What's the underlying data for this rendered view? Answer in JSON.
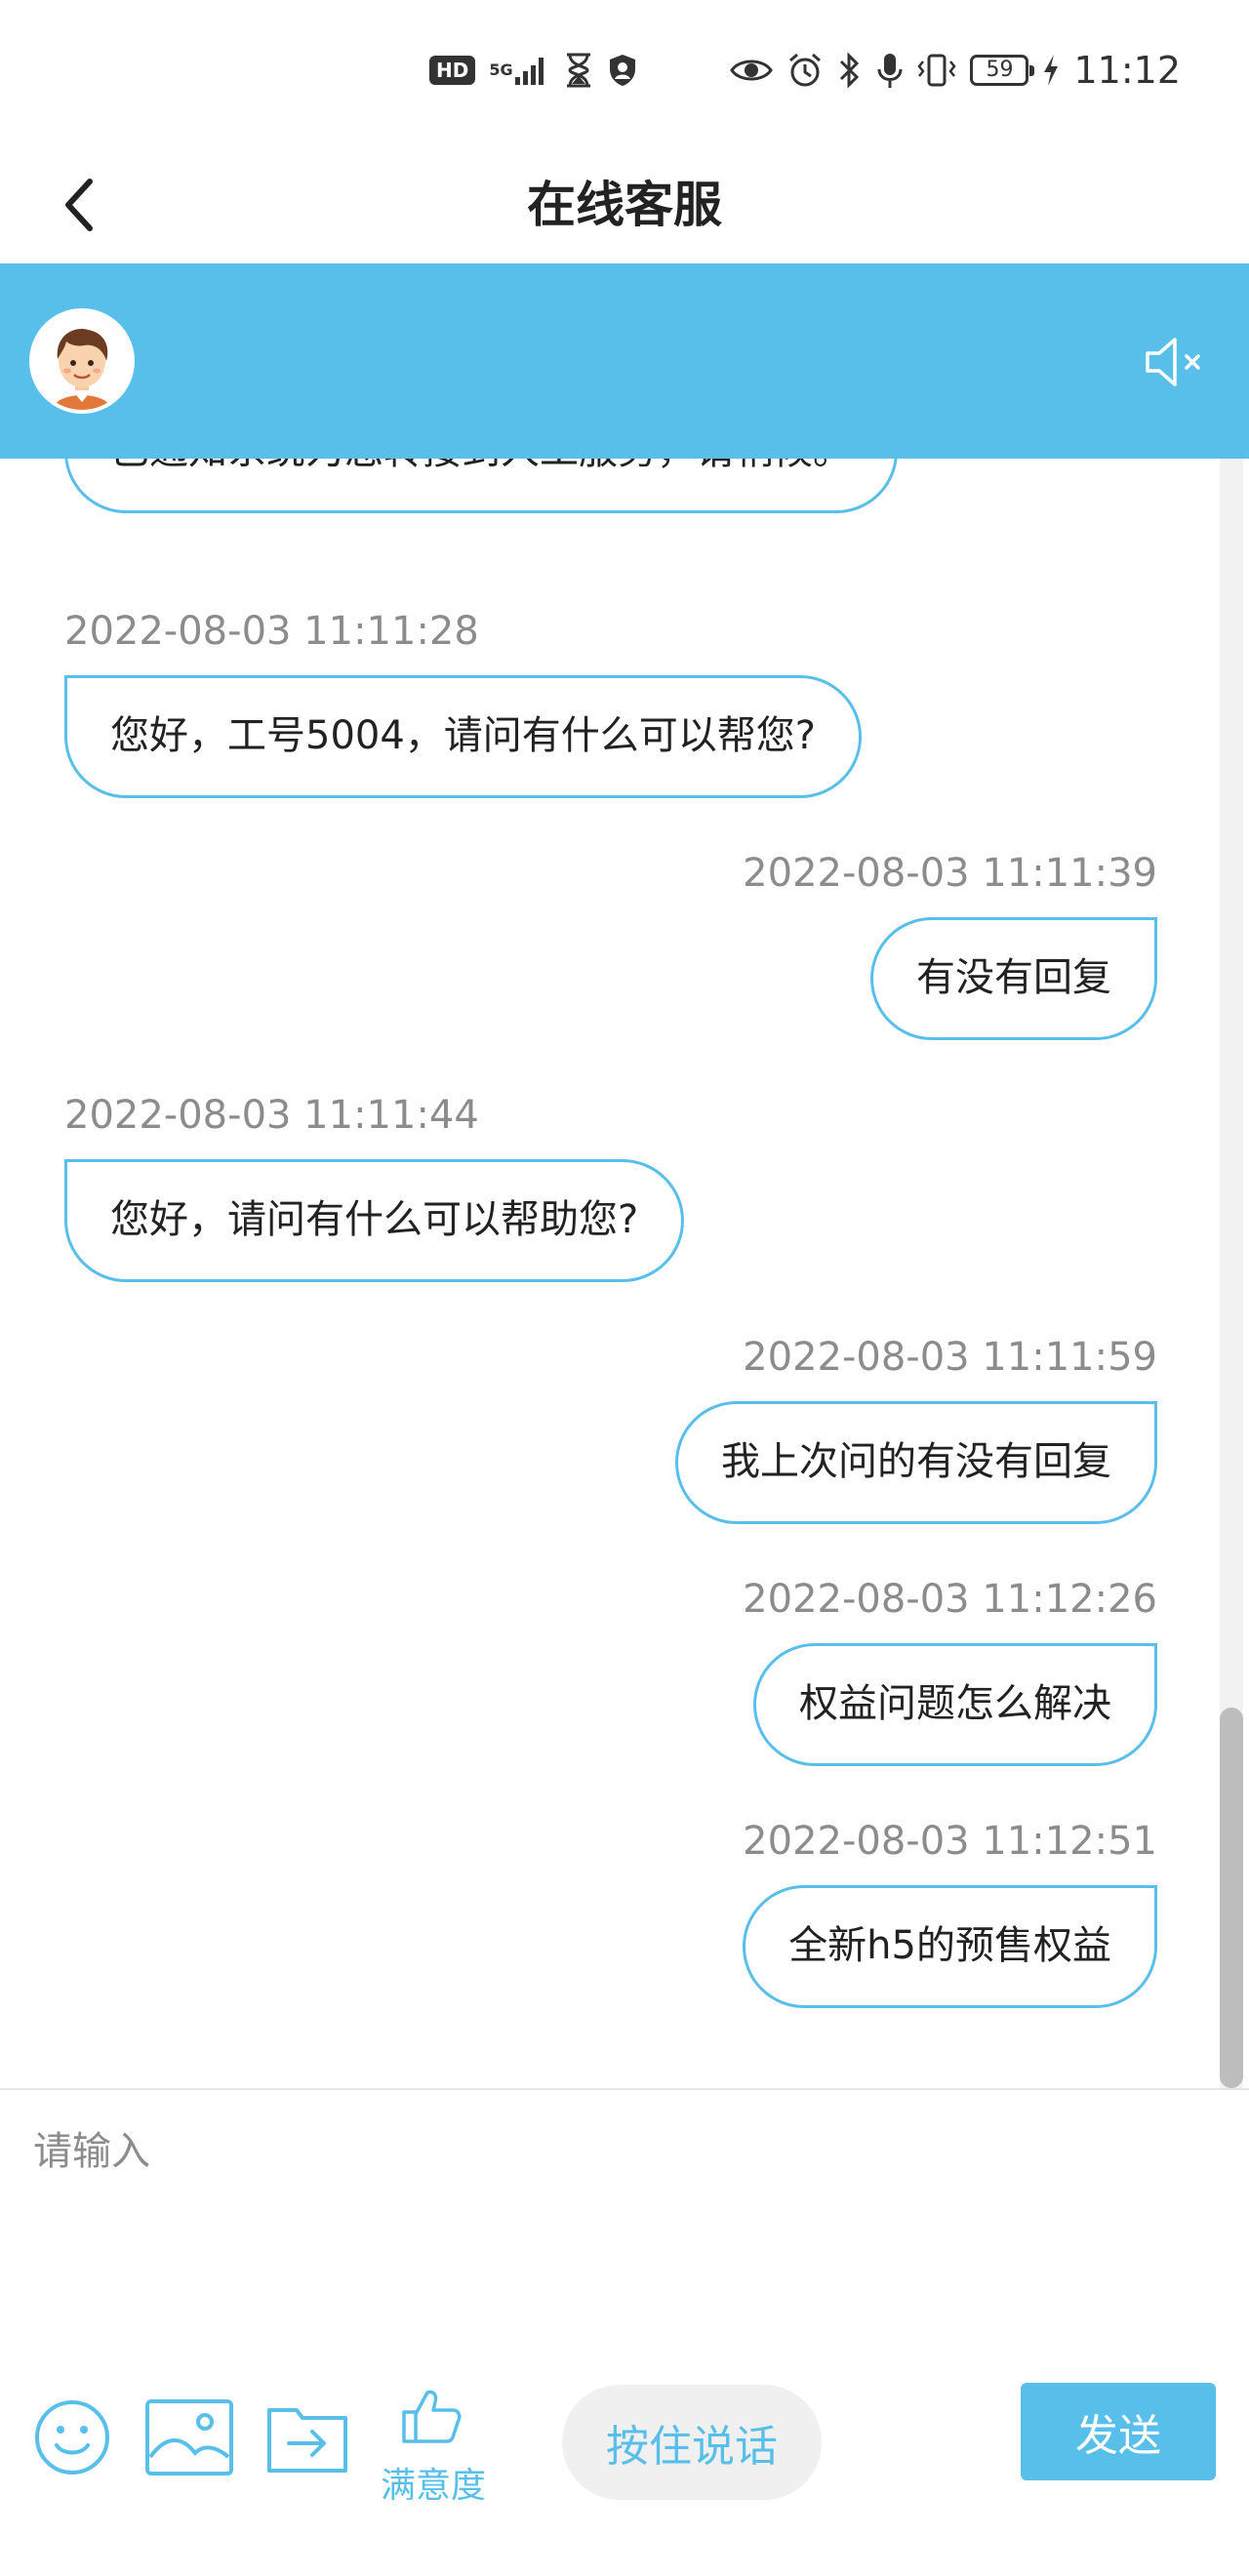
{
  "status_bar": {
    "hd_label": "HD",
    "network_label": "5G",
    "battery_level": "59",
    "time": "11:12"
  },
  "header": {
    "title": "在线客服",
    "back_icon": "chevron-left-icon"
  },
  "banner": {
    "avatar_icon": "agent-avatar",
    "mute_icon": "speaker-mute-icon",
    "color": "#58bfea"
  },
  "messages": [
    {
      "side": "left",
      "timestamp": "",
      "text": "已通知系统为您转接到人工服务，请稍候。"
    },
    {
      "side": "left",
      "timestamp": "2022-08-03 11:11:28",
      "text": "您好，工号5004，请问有什么可以帮您?"
    },
    {
      "side": "right",
      "timestamp": "2022-08-03 11:11:39",
      "text": "有没有回复"
    },
    {
      "side": "left",
      "timestamp": "2022-08-03 11:11:44",
      "text": "您好，请问有什么可以帮助您?"
    },
    {
      "side": "right",
      "timestamp": "2022-08-03 11:11:59",
      "text": "我上次问的有没有回复"
    },
    {
      "side": "right",
      "timestamp": "2022-08-03 11:12:26",
      "text": "权益问题怎么解决"
    },
    {
      "side": "right",
      "timestamp": "2022-08-03 11:12:51",
      "text": "全新h5的预售权益"
    }
  ],
  "input": {
    "placeholder": "请输入",
    "value": ""
  },
  "toolbar": {
    "emoji_icon": "emoji-icon",
    "image_icon": "image-icon",
    "file_icon": "file-transfer-icon",
    "rating_icon": "thumbs-up-icon",
    "rating_label": "满意度",
    "voice_label": "按住说话",
    "send_label": "发送"
  }
}
